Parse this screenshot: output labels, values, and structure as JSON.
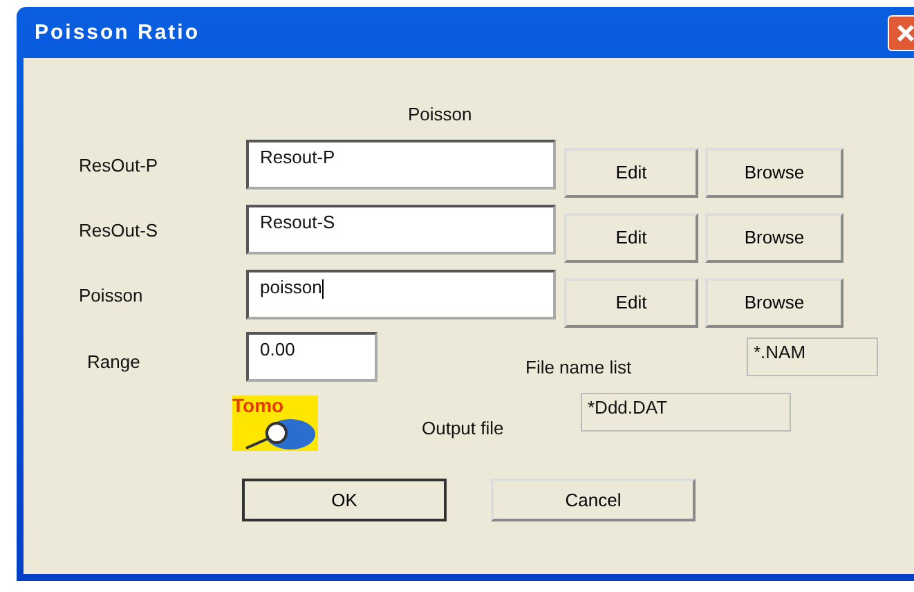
{
  "window": {
    "title": "Poisson Ratio"
  },
  "heading": "Poisson",
  "file_rows": [
    {
      "label": "ResOut-P",
      "value": "Resout-P",
      "edit": "Edit",
      "browse": "Browse"
    },
    {
      "label": "ResOut-S",
      "value": "Resout-S",
      "edit": "Edit",
      "browse": "Browse"
    },
    {
      "label": "Poisson",
      "value": "poisson",
      "edit": "Edit",
      "browse": "Browse",
      "focused": true
    }
  ],
  "range": {
    "label": "Range",
    "value": "0.00"
  },
  "file_name_list": {
    "label": "File name list",
    "value": "*.NAM"
  },
  "logo": {
    "text": "Tomo"
  },
  "output_file": {
    "label": "Output file",
    "value": "*Ddd.DAT"
  },
  "buttons": [
    {
      "label": "OK",
      "default": true
    },
    {
      "label": "Cancel",
      "default": false
    }
  ]
}
